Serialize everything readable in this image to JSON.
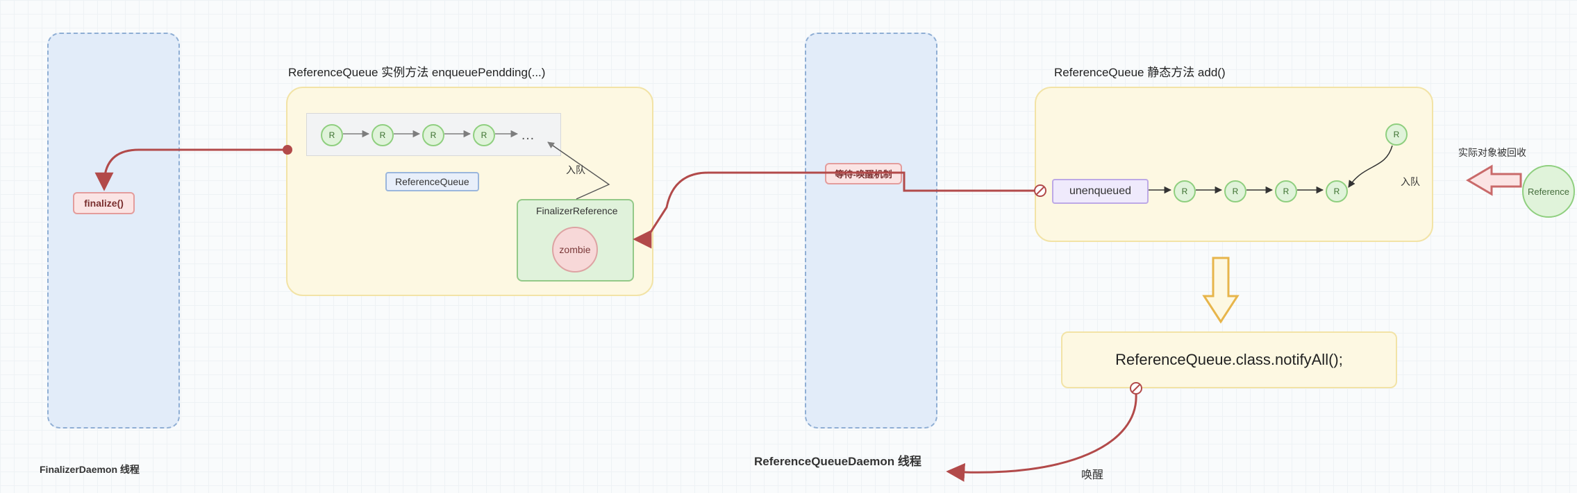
{
  "left_thread_box": {
    "caption": "FinalizerDaemon 线程"
  },
  "left_panel": {
    "title": "ReferenceQueue 实例方法 enqueuePendding(...)",
    "queue_badge": "ReferenceQueue",
    "enqueue_label": "入队",
    "ellipsis": "…",
    "node_label": "R",
    "finalizer_ref_box": {
      "title": "FinalizerReference",
      "zombie": "zombie"
    },
    "finalize_call": "finalize()"
  },
  "right_thread_box": {
    "caption": "ReferenceQueueDaemon 线程"
  },
  "right_panel": {
    "title": "ReferenceQueue 静态方法 add()",
    "unenqueued": "unenqueued",
    "enqueue_label": "入队",
    "node_label": "R"
  },
  "wait_label": "等待-唤醒机制",
  "notify_box": "ReferenceQueue.class.notifyAll();",
  "wake_label": "唤醒",
  "ext_ref": {
    "circle": "Reference",
    "caption": "实际对象被回收"
  }
}
